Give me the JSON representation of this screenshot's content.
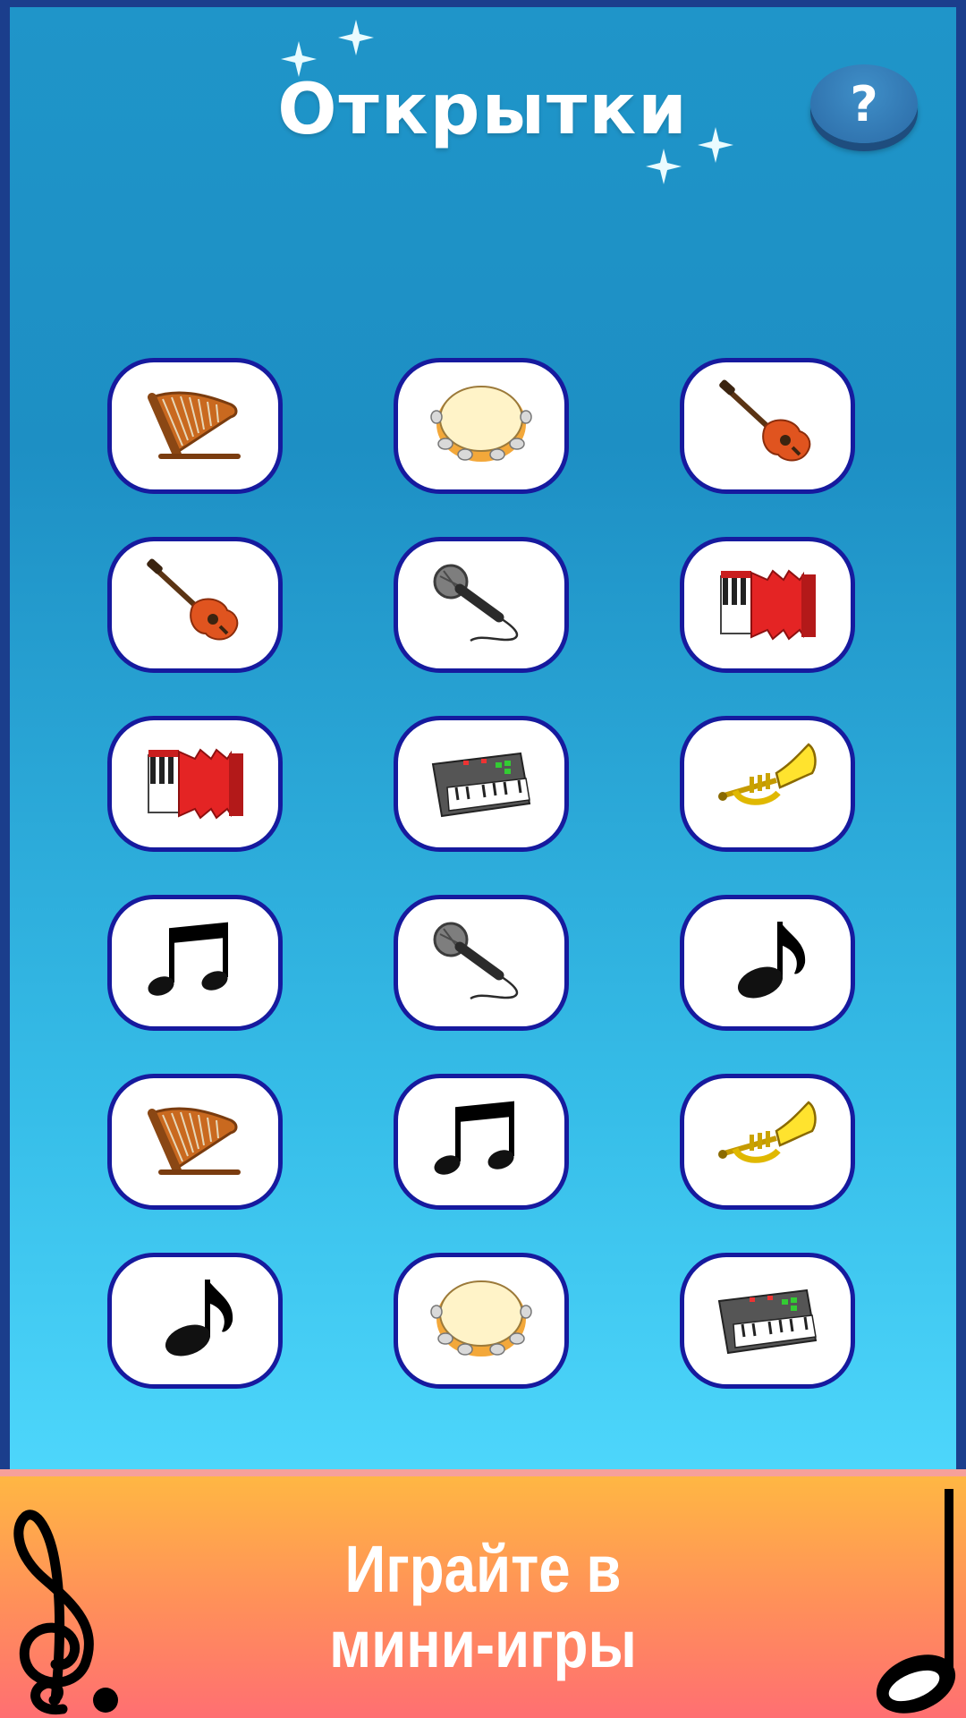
{
  "header": {
    "title": "Открытки",
    "help_label": "?"
  },
  "cards": [
    {
      "icon": "harp-icon"
    },
    {
      "icon": "tambourine-icon"
    },
    {
      "icon": "guitar-icon"
    },
    {
      "icon": "guitar-icon"
    },
    {
      "icon": "microphone-icon"
    },
    {
      "icon": "accordion-icon"
    },
    {
      "icon": "accordion-icon"
    },
    {
      "icon": "synthesizer-icon"
    },
    {
      "icon": "trumpet-icon"
    },
    {
      "icon": "beamed-notes-icon"
    },
    {
      "icon": "microphone-icon"
    },
    {
      "icon": "eighth-note-icon"
    },
    {
      "icon": "harp-icon"
    },
    {
      "icon": "beamed-notes-icon"
    },
    {
      "icon": "trumpet-icon"
    },
    {
      "icon": "eighth-note-icon"
    },
    {
      "icon": "tambourine-icon"
    },
    {
      "icon": "synthesizer-icon"
    }
  ],
  "banner": {
    "line1": "Играйте в",
    "line2": "мини-игры"
  },
  "colors": {
    "card_border": "#161a9e",
    "screen_top": "#1f95c9",
    "screen_bottom": "#4dd6fb",
    "banner_top": "#ffb942",
    "banner_bottom": "#ff6f72"
  }
}
